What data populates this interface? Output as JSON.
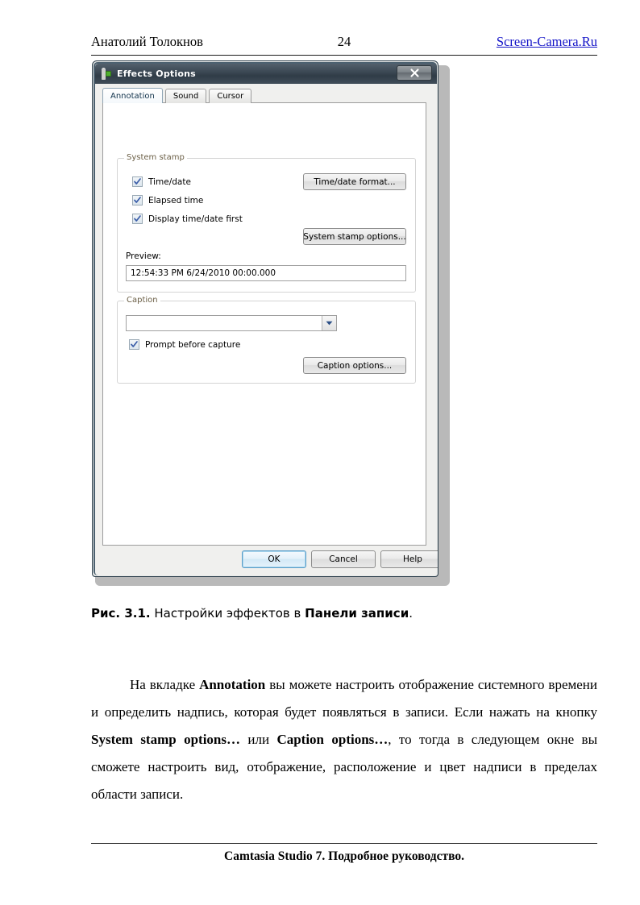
{
  "page": {
    "header": {
      "author": "Анатолий Толокнов",
      "page_number": "24",
      "site_link": "Screen-Camera.Ru",
      "link_color": "#1414c8"
    },
    "footer": {
      "text": "Camtasia Studio 7. Подробное руководство."
    },
    "figure_caption": {
      "label": "Рис. 3.1.",
      "text_1": " Настройки эффектов в ",
      "bold_2": "Панели записи",
      "text_3": "."
    },
    "paragraph": {
      "seg1": "На вкладке ",
      "bold1": "Annotation",
      "seg2": " вы можете настроить отображение системного времени и определить надпись, которая будет появляться в записи. Если нажать на кнопку ",
      "bold2": "System stamp options…",
      "seg3": " или ",
      "bold3": "Caption options…",
      "seg4": ", то тогда в следующем окне вы сможете настроить вид, отображение, расположение и цвет надписи в пределах области записи."
    }
  },
  "dialog": {
    "title": "Effects Options",
    "title_icon": "person-camera-icon",
    "close_button": "X",
    "tabs": [
      {
        "label": "Annotation",
        "active": true
      },
      {
        "label": "Sound",
        "active": false
      },
      {
        "label": "Cursor",
        "active": false
      }
    ],
    "system_stamp": {
      "group_title": "System stamp",
      "checkboxes": [
        {
          "label": "Time/date",
          "checked": true
        },
        {
          "label": "Elapsed time",
          "checked": true
        },
        {
          "label": "Display time/date first",
          "checked": true
        }
      ],
      "time_date_format_button": "Time/date format...",
      "system_stamp_options_button": "System stamp options...",
      "preview_label": "Preview:",
      "preview_value": "12:54:33 PM 6/24/2010 00:00.000"
    },
    "caption": {
      "group_title": "Caption",
      "combo_value": "",
      "combo_arrow_icon": "chevron-down-icon",
      "prompt_checkbox": {
        "label": "Prompt before capture",
        "checked": true
      },
      "caption_options_button": "Caption options..."
    },
    "bottom_buttons": [
      {
        "label": "OK",
        "focused": true
      },
      {
        "label": "Cancel",
        "focused": false
      },
      {
        "label": "Help",
        "focused": false
      }
    ]
  }
}
